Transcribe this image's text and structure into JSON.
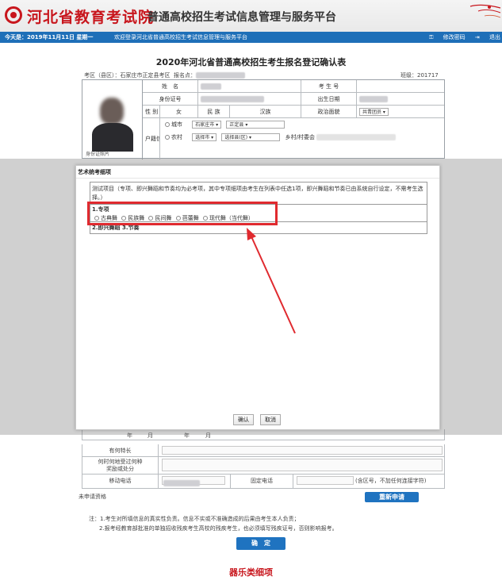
{
  "header": {
    "site_name": "河北省教育考试院",
    "platform_name": "普通高校招生考试信息管理与服务平台"
  },
  "navbar": {
    "date_text": "今天是：2019年11月11日 星期一",
    "welcome_text": "欢迎登录河北省普通高校招生考试信息管理与服务平台",
    "change_password": "修改密码",
    "logout": "退出"
  },
  "form": {
    "title": "2020年河北省普通高校招生考生报名登记确认表",
    "county_label": "考区（县区）：石家庄市正定县考区",
    "reg_no_label": "报名点：",
    "class_label": "班级：201717",
    "name_label": "姓　名",
    "exam_no_label": "考 生 号",
    "id_label": "身份证号",
    "birth_label": "出生日期",
    "gender_label": "性 别",
    "gender_value": "女",
    "ethnic_label": "民 族",
    "ethnic_value": "汉族",
    "politics_label": "政治面貌",
    "politics_value": "共青团员",
    "hukou_label": "户籍信息",
    "city_radio": "城市",
    "city_value": "石家庄市",
    "district_value": "正定县",
    "rural_radio": "农村",
    "select_city": "选择市",
    "select_county": "选择县(区)",
    "village_label": "乡村/村委会",
    "photo_caption": "身份证照片"
  },
  "modal": {
    "title": "艺术统考细项",
    "description": "测试项目（专项、即兴舞蹈和节奏均为必考项，其中专项细项由考生在列表中任选1项，即兴舞蹈和节奏已由系统自行设定，不需考生选择。）",
    "section1_title": "1.专项",
    "options": [
      "古典舞",
      "民族舞",
      "民间舞",
      "芭蕾舞",
      "现代舞（当代舞）"
    ],
    "section2_title": "2.即兴舞蹈  3.节奏",
    "confirm_button": "确认",
    "cancel_button": "取消"
  },
  "bottom": {
    "year_label": "年",
    "month_label": "月",
    "specialty_label": "有何特长",
    "award_label": "何时何地受过何种奖励或处分",
    "mobile_label": "移动电话",
    "phone_label": "固定电话",
    "phone_hint": "(含区号，不加任何连接字符)",
    "status_label": "未申请资格",
    "reapply_button": "重新申请",
    "note1": "注：1.考生对所填信息的真实性负责。信息不实或不准确造成的后果由考生本人负责；",
    "note2": "2.报考经教育部批准的单独招收残疾考生高校的残疾考生，也必须填写残疾证号，否则影响报考。",
    "submit_button": "确　定"
  },
  "caption": "器乐类细项",
  "colors": {
    "brand_red": "#c8161d",
    "nav_blue": "#1e6fb8",
    "highlight_red": "#e02a2f"
  }
}
